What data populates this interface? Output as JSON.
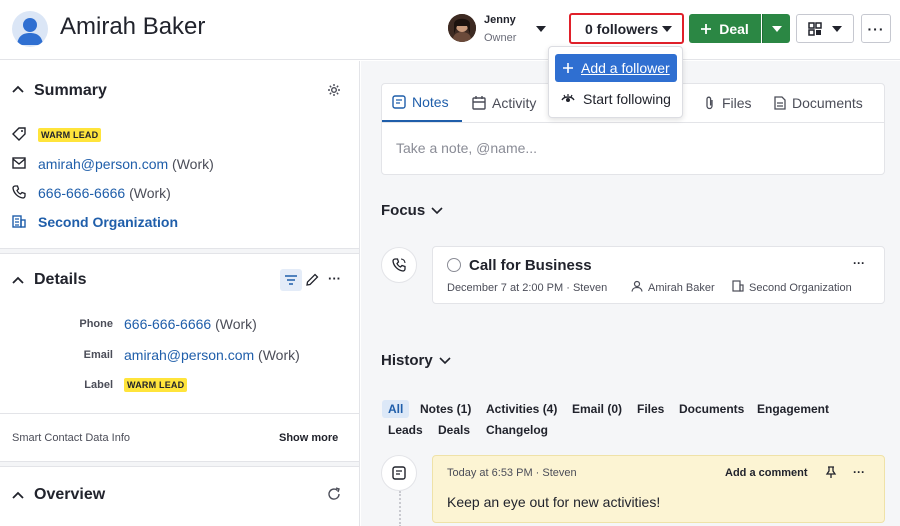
{
  "person": {
    "name": "Amirah Baker"
  },
  "owner": {
    "name": "Jenny",
    "role": "Owner"
  },
  "followers": {
    "label": "0 followers"
  },
  "deal_button": {
    "label": "Deal"
  },
  "more_label": "···",
  "follower_menu": {
    "add_label": "Add a follower",
    "follow_label": "Start following"
  },
  "summary": {
    "title": "Summary",
    "badge": "WARM LEAD",
    "email": "amirah@person.com",
    "email_type": "(Work)",
    "phone": "666-666-6666",
    "phone_type": "(Work)",
    "organization": "Second Organization"
  },
  "details": {
    "title": "Details",
    "phone_label": "Phone",
    "phone": "666-666-6666",
    "phone_type": "(Work)",
    "email_label": "Email",
    "email": "amirah@person.com",
    "email_type": "(Work)",
    "label_label": "Label",
    "label_value": "WARM LEAD"
  },
  "smart_data": {
    "title": "Smart Contact Data Info",
    "action": "Show more"
  },
  "overview": {
    "title": "Overview"
  },
  "composer": {
    "tabs": [
      "Notes",
      "Activity",
      "Files",
      "Documents"
    ],
    "placeholder": "Take a note, @name..."
  },
  "focus": {
    "title": "Focus",
    "activity": {
      "title": "Call for Business",
      "datetime": "December 7 at 2:00 PM · Steven",
      "person": "Amirah Baker",
      "organization": "Second Organization",
      "more": "···"
    }
  },
  "history": {
    "title": "History",
    "filters_row1": [
      "All",
      "Notes (1)",
      "Activities (4)",
      "Email (0)",
      "Files",
      "Documents",
      "Engagement"
    ],
    "filters_row2": [
      "Leads",
      "Deals",
      "Changelog"
    ],
    "note": {
      "meta": "Today at 6:53 PM · Steven",
      "action": "Add a comment",
      "more": "···",
      "text": "Keep an eye out for new activities!"
    }
  },
  "colors": {
    "brand_green": "#2b8744",
    "link_blue": "#1f5eaa",
    "highlight_red": "#e0202a",
    "badge_yellow": "#ffe43b"
  }
}
